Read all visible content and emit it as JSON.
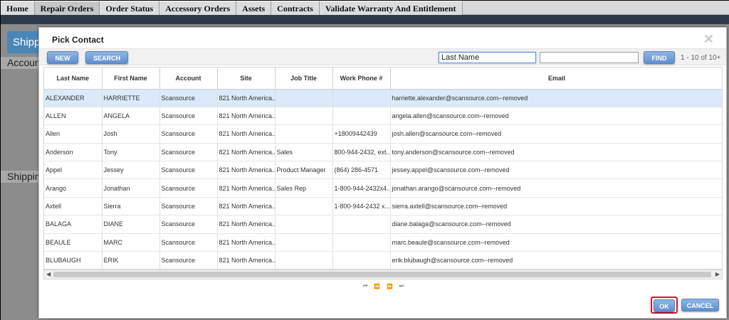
{
  "nav": {
    "items": [
      {
        "label": "Home"
      },
      {
        "label": "Repair Orders",
        "active": true
      },
      {
        "label": "Order Status"
      },
      {
        "label": "Accessory Orders"
      },
      {
        "label": "Assets"
      },
      {
        "label": "Contracts"
      },
      {
        "label": "Validate Warranty And Entitlement"
      }
    ]
  },
  "background": {
    "ship_button": "Shipp",
    "account_bar": "Accoun",
    "shipping_bar": "Shippin"
  },
  "dialog": {
    "title": "Pick Contact",
    "close_icon": "close-icon",
    "toolbar": {
      "new_label": "NEW",
      "search_label": "SEARCH",
      "field_value": "Last Name",
      "value_placeholder": "",
      "find_label": "FIND",
      "count": "1 - 10 of 10+"
    },
    "columns": [
      "Last Name",
      "First Name",
      "Account",
      "Site",
      "Job Title",
      "Work Phone #",
      "Email"
    ],
    "rows": [
      {
        "last": "ALEXANDER",
        "first": "HARRIETTE",
        "account": "Scansource",
        "site": "821 North America...",
        "job": "",
        "phone": "",
        "email": "harriette.alexander@scansource.com--removed"
      },
      {
        "last": "ALLEN",
        "first": "ANGELA",
        "account": "Scansource",
        "site": "821 North America...",
        "job": "",
        "phone": "",
        "email": "angela.allen@scansource.com--removed"
      },
      {
        "last": "Allen",
        "first": "Josh",
        "account": "Scansource",
        "site": "821 North America...",
        "job": "",
        "phone": "+18009442439",
        "email": "josh.allen@scansource.com--removed"
      },
      {
        "last": "Anderson",
        "first": "Tony",
        "account": "Scansource",
        "site": "821 North America...",
        "job": "Sales",
        "phone": "800-944-2432, ext...",
        "email": "tony.anderson@scansource.com--removed"
      },
      {
        "last": "Appel",
        "first": "Jessey",
        "account": "Scansource",
        "site": "821 North America...",
        "job": "Product Manager",
        "phone": "(864) 286-4571",
        "email": "jessey.appel@scansource.com--removed"
      },
      {
        "last": "Arango",
        "first": "Jonathan",
        "account": "Scansource",
        "site": "821 North America...",
        "job": "Sales Rep",
        "phone": "1-800-944-2432x4...",
        "email": "jonathan.arango@scansource.com--removed"
      },
      {
        "last": "Axtell",
        "first": "Sierra",
        "account": "Scansource",
        "site": "821 North America...",
        "job": "",
        "phone": "1-800-944-2432 x...",
        "email": "sierra.axtell@scansource.com--removed"
      },
      {
        "last": "BALAGA",
        "first": "DIANE",
        "account": "Scansource",
        "site": "821 North America...",
        "job": "",
        "phone": "",
        "email": "diane.balaga@scansource.com--removed"
      },
      {
        "last": "BEAULE",
        "first": "MARC",
        "account": "Scansource",
        "site": "821 North America...",
        "job": "",
        "phone": "",
        "email": "marc.beaule@scansource.com--removed"
      },
      {
        "last": "BLUBAUGH",
        "first": "ERIK",
        "account": "Scansource",
        "site": "821 North America...",
        "job": "",
        "phone": "",
        "email": "erik.blubaugh@scansource.com--removed"
      }
    ],
    "pager": {
      "first": "⏮",
      "prev": "⏪",
      "next": "⏩",
      "last": "⏭"
    },
    "ok_label": "OK",
    "cancel_label": "CANCEL"
  },
  "colors": {
    "accent": "#5f8fcf",
    "selected_row": "#dbe9f8",
    "highlight_ring": "#d9102a"
  }
}
